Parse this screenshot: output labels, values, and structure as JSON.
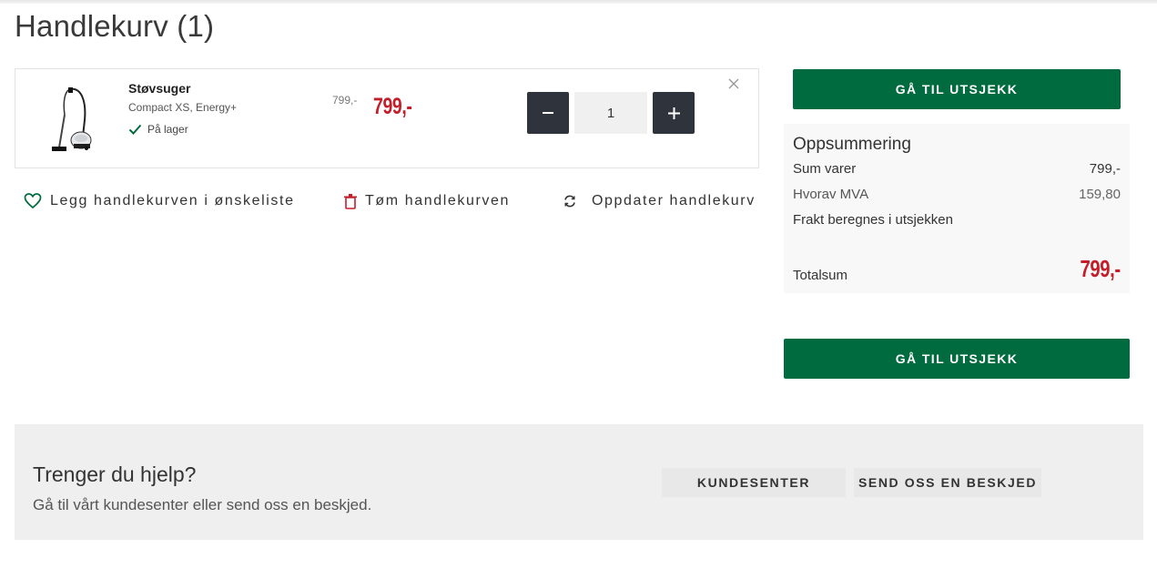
{
  "page": {
    "title": "Handlekurv (1)"
  },
  "cart_item": {
    "name": "Støvsuger",
    "variant": "Compact XS, Energy+",
    "stock": "På lager",
    "old_price": "799,-",
    "price": "799,-",
    "quantity": "1"
  },
  "actions": {
    "wishlist": "Legg handlekurven i ønskeliste",
    "empty": "Tøm handlekurven",
    "update": "Oppdater handlekurv"
  },
  "checkout": {
    "label": "GÅ TIL UTSJEKK"
  },
  "summary": {
    "title": "Oppsummering",
    "sum_label": "Sum varer",
    "sum_value": "799,-",
    "vat_label": "Hvorav MVA",
    "vat_value": "159,80",
    "freight_label": "Frakt beregnes i utsjekken",
    "total_label": "Totalsum",
    "total_value": "799,-"
  },
  "help": {
    "title": "Trenger du hjelp?",
    "text": "Gå til vårt kundesenter eller send oss en beskjed.",
    "customer_center": "KUNDESENTER",
    "send_message": "SEND OSS EN BESKJED"
  },
  "icons": {
    "wishlist": "heart-icon",
    "empty": "trash-icon",
    "update": "refresh-icon",
    "remove": "close-icon",
    "stock": "checkmark-icon",
    "minus": "minus-icon",
    "plus": "plus-icon"
  },
  "colors": {
    "accent_green": "#006b3f",
    "price_red": "#c41e2b",
    "stepper_dark": "#2f333b"
  }
}
